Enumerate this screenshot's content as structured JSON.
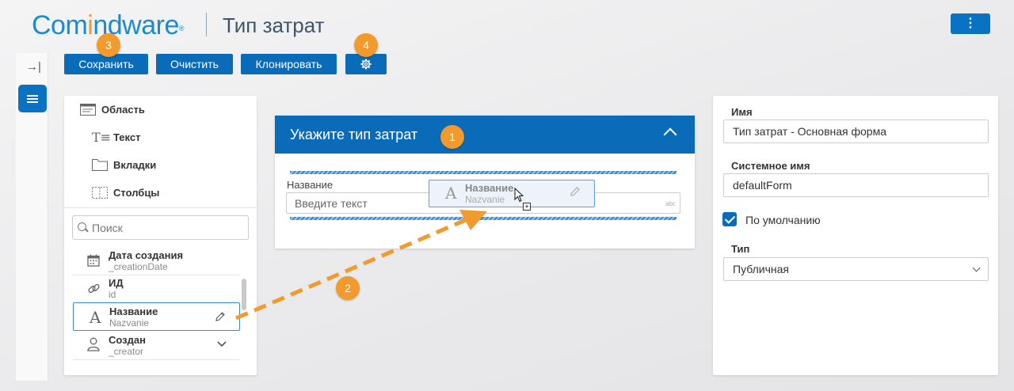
{
  "header": {
    "logo": {
      "part1": "Com",
      "part2": "i",
      "part3": "ndware",
      "reg": "®"
    },
    "title": "Тип затрат",
    "menu_icon": "⋮"
  },
  "toolbar": {
    "save_label": "Сохранить",
    "clear_label": "Очистить",
    "clone_label": "Клонировать",
    "settings_icon": "gear-icon"
  },
  "rail": {
    "expand_icon": "→|"
  },
  "toolbox": {
    "items": [
      {
        "label": "Область",
        "icon": "area-icon"
      },
      {
        "label": "Текст",
        "icon": "text-icon"
      },
      {
        "label": "Вкладки",
        "icon": "tabs-icon"
      },
      {
        "label": "Столбцы",
        "icon": "columns-icon"
      }
    ],
    "search_placeholder": "Поиск"
  },
  "fields": [
    {
      "name": "Дата создания",
      "system": "_creationDate",
      "icon": "calendar-icon"
    },
    {
      "name": "ИД",
      "system": "id",
      "icon": "link-icon"
    },
    {
      "name": "Название",
      "system": "Nazvanie",
      "icon": "text-a-icon",
      "selected": true
    },
    {
      "name": "Создан",
      "system": "_creator",
      "icon": "user-icon"
    }
  ],
  "form": {
    "title": "Укажите тип затрат",
    "field_label": "Название",
    "field_placeholder": "Введите текст",
    "field_type": "abc",
    "drag_ghost": {
      "name": "Название",
      "system": "Nazvanie"
    }
  },
  "properties": {
    "name_label": "Имя",
    "name_value": "Тип затрат - Основная форма",
    "sysname_label": "Системное имя",
    "sysname_value": "defaultForm",
    "default_label": "По умолчанию",
    "default_checked": true,
    "type_label": "Тип",
    "type_value": "Публичная"
  },
  "callouts": {
    "c1": "1",
    "c2": "2",
    "c3": "3",
    "c4": "4"
  },
  "colors": {
    "primary": "#0a6cb8",
    "accent": "#f29a2e"
  }
}
